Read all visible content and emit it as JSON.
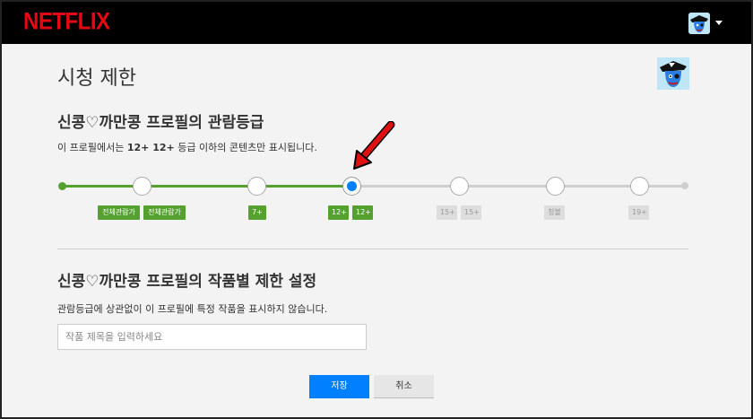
{
  "header": {
    "logo": "NETFLIX"
  },
  "page": {
    "title": "시청 제한"
  },
  "maturity": {
    "title": "신콩♡까만콩 프로필의 관람등급",
    "desc_prefix": "이 프로필에서는 ",
    "desc_rating": "12+ 12+",
    "desc_suffix": " 등급 이하의 콘텐츠만 표시됩니다.",
    "selected_level": "12+",
    "badges": [
      "전체관람가",
      "전체관람가",
      "7+",
      "12+",
      "12+",
      "15+",
      "15+",
      "청불",
      "19+"
    ]
  },
  "restrictions": {
    "title": "신콩♡까만콩 프로필의 작품별 제한 설정",
    "desc": "관람등급에 상관없이 이 프로필에 특정 작품을 표시하지 않습니다.",
    "search_placeholder": "작품 제목을 입력하세요"
  },
  "buttons": {
    "save": "저장",
    "cancel": "취소"
  },
  "colors": {
    "brand": "#e50914",
    "accent": "#0080ff",
    "allowed": "#54a130",
    "arrow": "#e01010"
  }
}
